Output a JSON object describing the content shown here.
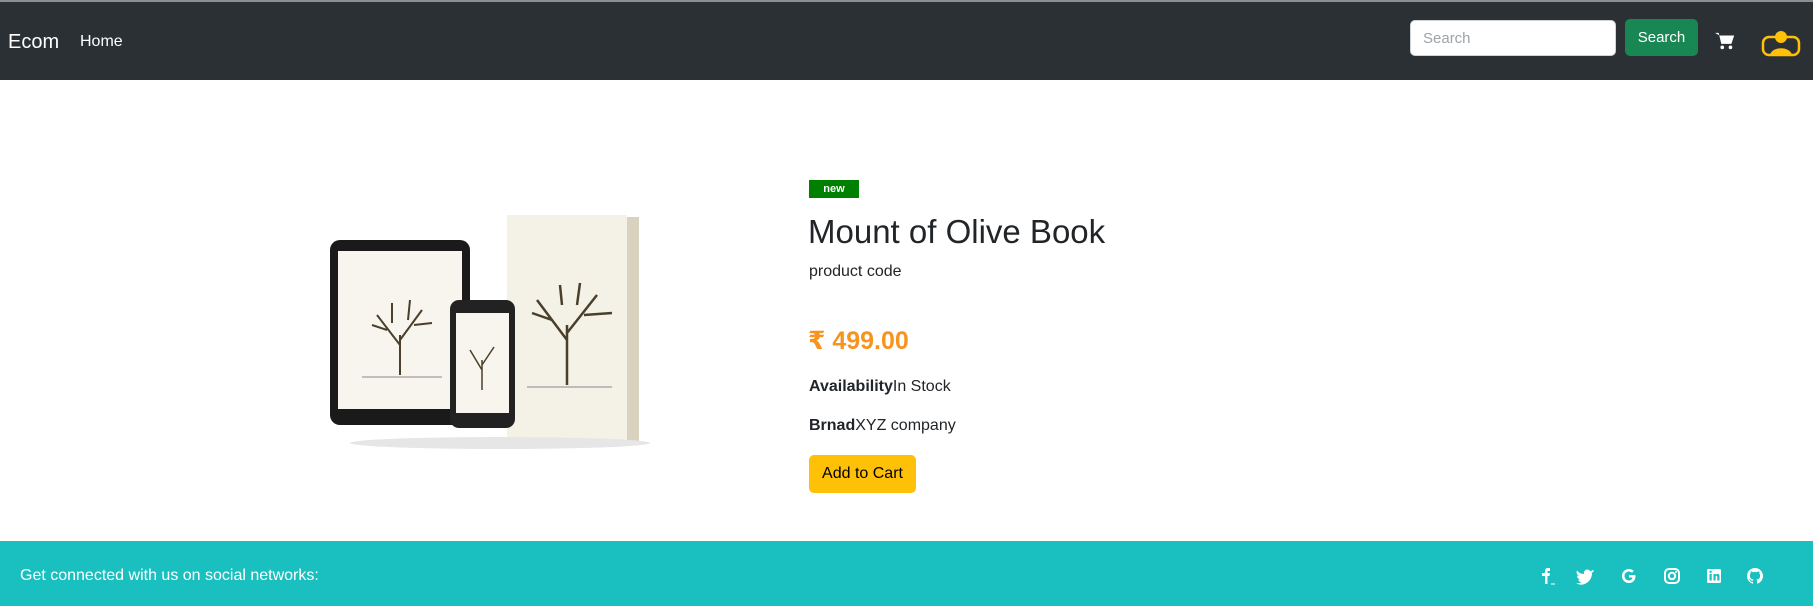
{
  "navbar": {
    "brand": "Ecom",
    "home_label": "Home",
    "search_placeholder": "Search",
    "search_button": "Search"
  },
  "product": {
    "badge": "new",
    "title": "Mount of Olive Book",
    "code": "product code",
    "price": "₹ 499.00",
    "availability_label": "Availability",
    "availability_value": "In Stock",
    "brand_label": "Brnad",
    "brand_value": "XYZ company",
    "add_to_cart": "Add to Cart"
  },
  "footer": {
    "text": "Get connected with us on social networks:",
    "social_icons": [
      "facebook-icon",
      "twitter-icon",
      "google-icon",
      "instagram-icon",
      "linkedin-icon",
      "github-icon"
    ]
  },
  "colors": {
    "navbar_bg": "#2b3035",
    "search_button": "#198754",
    "badge": "#008000",
    "price": "#f7941d",
    "add_to_cart": "#ffc107",
    "footer_bg": "#1abfbf",
    "user_icon": "#ffc107"
  }
}
